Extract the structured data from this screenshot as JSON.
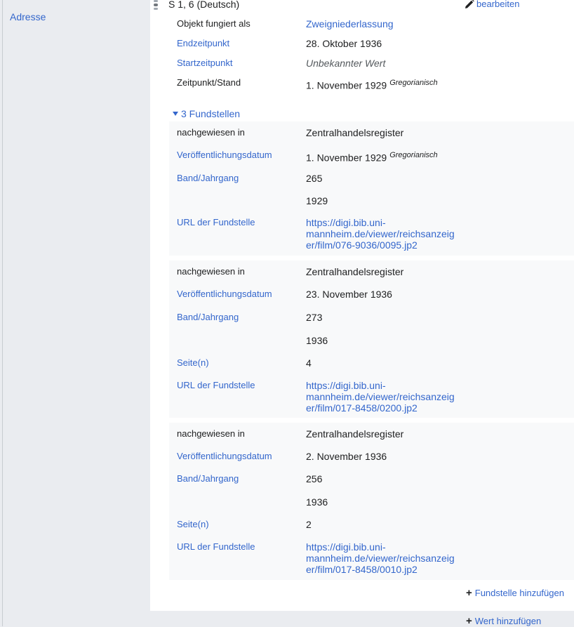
{
  "property": {
    "label": "Adresse"
  },
  "statement": {
    "value": "S 1, 6 (Deutsch)",
    "edit_label": "bearbeiten",
    "qualifiers": [
      {
        "label": "Objekt fungiert als",
        "value": "Zweigniederlassung",
        "value_is_link": true,
        "label_dark": true
      },
      {
        "label": "Endzeitpunkt",
        "value": "28. Oktober 1936"
      },
      {
        "label": "Startzeitpunkt",
        "value": "Unbekannter Wert",
        "value_italic": true
      },
      {
        "label": "Zeitpunkt/Stand",
        "value": "1. November 1929",
        "calendar": "Gregorianisch",
        "label_dark": true
      }
    ],
    "references_toggle": "3 Fundstellen",
    "references": [
      {
        "stated_in_label": "nachgewiesen in",
        "stated_in": "Zentralhandelsregister",
        "date_label": "Veröffentlichungsdatum",
        "date": "1. November 1929",
        "calendar": "Gregorianisch",
        "volume_label": "Band/Jahrgang",
        "volume": "265",
        "year": "1929",
        "url_label": "URL der Fundstelle",
        "url_lines": [
          "https://digi.bib.uni-",
          "mannheim.de/viewer/reichsanzeig",
          "er/film/076-9036/0095.jp2"
        ]
      },
      {
        "stated_in_label": "nachgewiesen in",
        "stated_in": "Zentralhandelsregister",
        "date_label": "Veröffentlichungsdatum",
        "date": "23. November 1936",
        "volume_label": "Band/Jahrgang",
        "volume": "273",
        "year": "1936",
        "pages_label": "Seite(n)",
        "pages": "4",
        "url_label": "URL der Fundstelle",
        "url_lines": [
          "https://digi.bib.uni-",
          "mannheim.de/viewer/reichsanzeig",
          "er/film/017-8458/0200.jp2"
        ]
      },
      {
        "stated_in_label": "nachgewiesen in",
        "stated_in": "Zentralhandelsregister",
        "date_label": "Veröffentlichungsdatum",
        "date": "2. November 1936",
        "volume_label": "Band/Jahrgang",
        "volume": "256",
        "year": "1936",
        "pages_label": "Seite(n)",
        "pages": "2",
        "url_label": "URL der Fundstelle",
        "url_lines": [
          "https://digi.bib.uni-",
          "mannheim.de/viewer/reichsanzeig",
          "er/film/017-8458/0010.jp2"
        ]
      }
    ],
    "add_reference_label": "Fundstelle hinzufügen"
  },
  "add_value_label": "Wert hinzufügen",
  "colors": {
    "link": "#3366cc",
    "text": "#202122",
    "panel": "#f8f9fa",
    "background": "#eaecf0"
  },
  "icons": {
    "rank": "normal-rank-icon",
    "edit": "pencil-icon",
    "toggle": "caret-down-icon",
    "add": "plus-icon"
  }
}
